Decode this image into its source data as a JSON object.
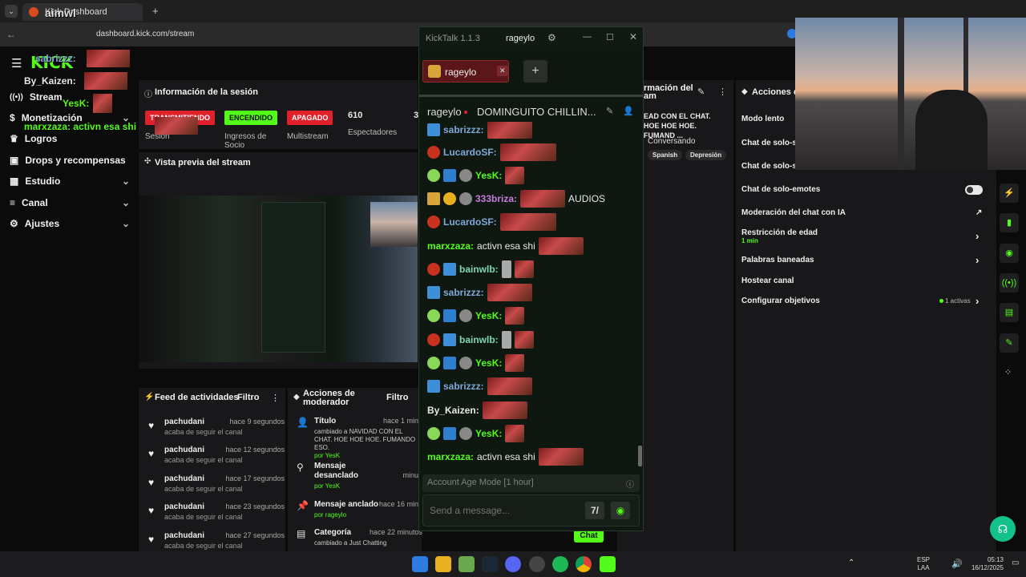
{
  "browser": {
    "tab_title": "Kick Dashboard",
    "url": "dashboard.kick.com/stream",
    "new_tab": "+"
  },
  "sidebar": {
    "items": [
      {
        "label": "Stream",
        "icon": "broadcast-icon"
      },
      {
        "label": "Monetización",
        "icon": "dollar-icon"
      },
      {
        "label": "Logros",
        "icon": "trophy-icon"
      },
      {
        "label": "Drops y recompensas",
        "icon": "gift-icon"
      },
      {
        "label": "Estudio",
        "icon": "grid-icon"
      },
      {
        "label": "Canal",
        "icon": "list-icon"
      },
      {
        "label": "Ajustes",
        "icon": "gear-icon"
      }
    ]
  },
  "session": {
    "title": "Información de la sesión",
    "pills": {
      "transmitting": "TRANSMITIENDO",
      "on": "ENCENDIDO",
      "off": "APAGADO"
    },
    "labels": {
      "session": "Sesión",
      "income": "Ingresos de Socio",
      "multistream": "Multistream",
      "viewers": "Espectadores"
    },
    "viewers": "610",
    "partial": "3"
  },
  "preview": {
    "title": "Vista previa del stream"
  },
  "info_panel": {
    "title_partial": "rmación del",
    "title_partial2": "am",
    "stream_title_partial": "EAD CON EL CHAT. HOE HOE HOE. FUMAND ...",
    "category": "Conversando",
    "tags": [
      "Spanish",
      "Depresión"
    ]
  },
  "activity": {
    "title": "Feed de actividades",
    "filter": "Filtro",
    "items": [
      {
        "name": "pachudani",
        "time": "hace 9 segundos",
        "sub": "acaba de seguir el canal"
      },
      {
        "name": "pachudani",
        "time": "hace 12 segundos",
        "sub": "acaba de seguir el canal"
      },
      {
        "name": "pachudani",
        "time": "hace 17 segundos",
        "sub": "acaba de seguir el canal"
      },
      {
        "name": "pachudani",
        "time": "hace 23 segundos",
        "sub": "acaba de seguir el canal"
      },
      {
        "name": "pachudani",
        "time": "hace 27 segundos",
        "sub": "acaba de seguir el canal"
      }
    ]
  },
  "mod_actions": {
    "title": "Acciones de moderador",
    "filter": "Filtro",
    "items": [
      {
        "title": "Título",
        "time": "hace 1 min",
        "desc": "cambiado a NAVIDAD CON EL CHAT. HOE HOE HOE. FUMANDO ESO.",
        "by": "por YesK"
      },
      {
        "title": "Mensaje desanclado",
        "time": "minu",
        "desc": "",
        "by": "por YesK"
      },
      {
        "title": "Mensaje anclado",
        "time": "hace 16 minu",
        "desc": "",
        "by": "por rageylo"
      },
      {
        "title": "Categoría",
        "time": "hace 22 minutos",
        "desc": "cambiado a Just Chatting",
        "by": "por YesK"
      }
    ]
  },
  "mod_settings": {
    "title": "Acciones de",
    "items": [
      {
        "label": "Modo lento"
      },
      {
        "label": "Chat de solo-s"
      },
      {
        "label": "Chat de solo-s"
      },
      {
        "label": "Chat de solo-emotes"
      },
      {
        "label": "Moderación del chat con IA"
      },
      {
        "label": "Restricción de edad",
        "sub": "1 min"
      },
      {
        "label": "Palabras baneadas"
      },
      {
        "label": "Hostear canal"
      },
      {
        "label": "Configurar objetivos",
        "extra": "1 activas"
      }
    ]
  },
  "kicktalk": {
    "app_title": "KickTalk 1.1.3",
    "account": "rageylo",
    "chat_tab": "rageylo",
    "channel": "rageylo",
    "stream_title": "DOMINGUITO CHILLIN...",
    "messages": [
      {
        "user": "sabrizzz:",
        "color": "#7fa8d8",
        "text": ""
      },
      {
        "user": "LucardoSF:",
        "color": "#7fa8d8",
        "text": ""
      },
      {
        "user": "YesK:",
        "color": "#53fc18",
        "text": ""
      },
      {
        "user": "333briza:",
        "color": "#c77ce0",
        "text": "AUDIOS"
      },
      {
        "user": "LucardoSF:",
        "color": "#7fa8d8",
        "text": ""
      },
      {
        "user": "marxzaza:",
        "color": "#53fc18",
        "text": "activn esa shi"
      },
      {
        "user": "bainwlb:",
        "color": "#7fd8b0",
        "text": ""
      },
      {
        "user": "sabrizzz:",
        "color": "#7fa8d8",
        "text": ""
      },
      {
        "user": "YesK:",
        "color": "#53fc18",
        "text": ""
      },
      {
        "user": "bainwlb:",
        "color": "#7fd8b0",
        "text": ""
      },
      {
        "user": "YesK:",
        "color": "#53fc18",
        "text": ""
      },
      {
        "user": "sabrizzz:",
        "color": "#7fa8d8",
        "text": ""
      },
      {
        "user": "By_Kaizen:",
        "color": "#e8e8e8",
        "text": ""
      },
      {
        "user": "YesK:",
        "color": "#53fc18",
        "text": ""
      },
      {
        "user": "marxzaza:",
        "color": "#53fc18",
        "text": "activn esa shi"
      }
    ],
    "info_bar": "Account Age Mode [1 hour]",
    "input_placeholder": "Send a message..."
  },
  "overlay": {
    "lines": [
      "sabrizzz:",
      "By_Kaizen:",
      "YesK:",
      "marxzaza: activn esa shi"
    ],
    "top_text": "aimwl"
  },
  "chat_button": "Chat",
  "taskbar": {
    "lang": "ESP",
    "region": "LAA",
    "time": "05:13",
    "date": "16/12/2025"
  }
}
